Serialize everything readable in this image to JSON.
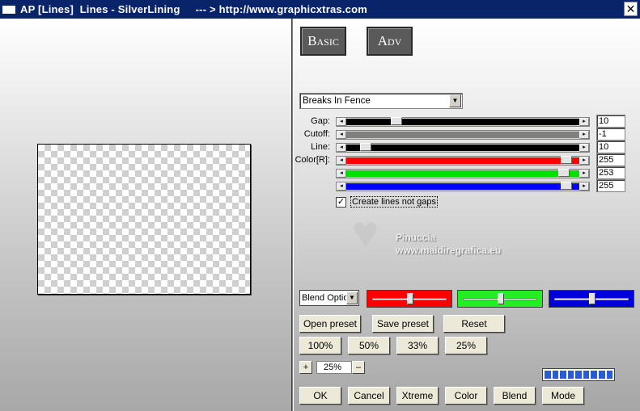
{
  "window": {
    "title": "AP [Lines]  Lines - SilverLining     --- > http://www.graphicxtras.com",
    "close_glyph": "✕"
  },
  "tabs": [
    {
      "label": "Basic"
    },
    {
      "label": "Adv"
    }
  ],
  "mode_select": {
    "value": "Breaks In Fence"
  },
  "sliders": [
    {
      "label": "Gap:",
      "value": "10",
      "fill": "#000000",
      "position": 0.2
    },
    {
      "label": "Cutoff:",
      "value": "-1",
      "fill": "#808080",
      "position": null
    },
    {
      "label": "Line:",
      "value": "10",
      "fill": "#000000",
      "position": 0.06
    },
    {
      "label": "Color[R]:",
      "value": "255",
      "fill": "#ff0000",
      "position": 0.96
    },
    {
      "label": "",
      "value": "253",
      "fill": "#00e000",
      "position": 0.95
    },
    {
      "label": "",
      "value": "255",
      "fill": "#0000ff",
      "position": 0.96
    }
  ],
  "checkbox": {
    "label": "Create lines not gaps",
    "checked": true,
    "mark": "✓"
  },
  "watermark": {
    "line1": "Pinuccia",
    "line2": "www.maidiregrafica.eu",
    "heart_icon": "♥"
  },
  "blend": {
    "select_value": "Blend Optio",
    "color_sliders": [
      {
        "color": "#ff0000",
        "position": 0.5
      },
      {
        "color": "#22ee22",
        "position": 0.5
      },
      {
        "color": "#0000dd",
        "position": 0.5
      }
    ]
  },
  "preset_buttons": [
    "Open preset",
    "Save preset",
    "Reset"
  ],
  "zoom_buttons": [
    "100%",
    "50%",
    "33%",
    "25%"
  ],
  "zoom": {
    "plus": "+",
    "minus": "–",
    "value": "25%"
  },
  "progress": {
    "segments": 9,
    "filled": 9
  },
  "bottom_buttons": [
    "OK",
    "Cancel",
    "Xtreme",
    "Color",
    "Blend",
    "Mode"
  ],
  "arrows": {
    "left": "◂",
    "right": "▸",
    "down": "▼"
  }
}
